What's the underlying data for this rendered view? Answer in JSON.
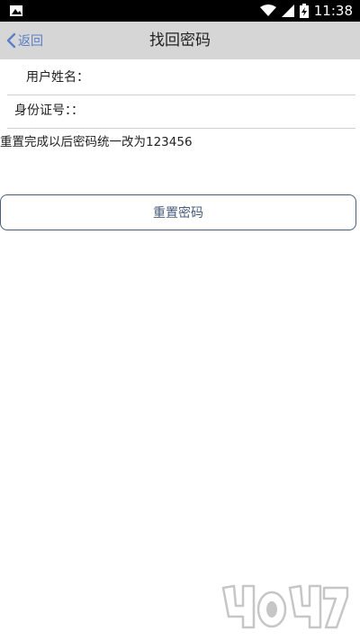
{
  "status_bar": {
    "time": "11:38",
    "left_icon": "image-icon",
    "icons": [
      "wifi-icon",
      "signal-icon",
      "battery-icon"
    ]
  },
  "nav": {
    "back_label": "返回",
    "title": "找回密码"
  },
  "form": {
    "username_label": "用户姓名：",
    "username_value": "",
    "id_label": "身份证号：：",
    "id_value": ""
  },
  "hint": "重置完成以后密码统一改为123456",
  "reset_button_label": "重置密码",
  "colors": {
    "nav_bg": "#d6d6d6",
    "accent": "#5b7ec8",
    "button_border": "#4a5d7d"
  }
}
